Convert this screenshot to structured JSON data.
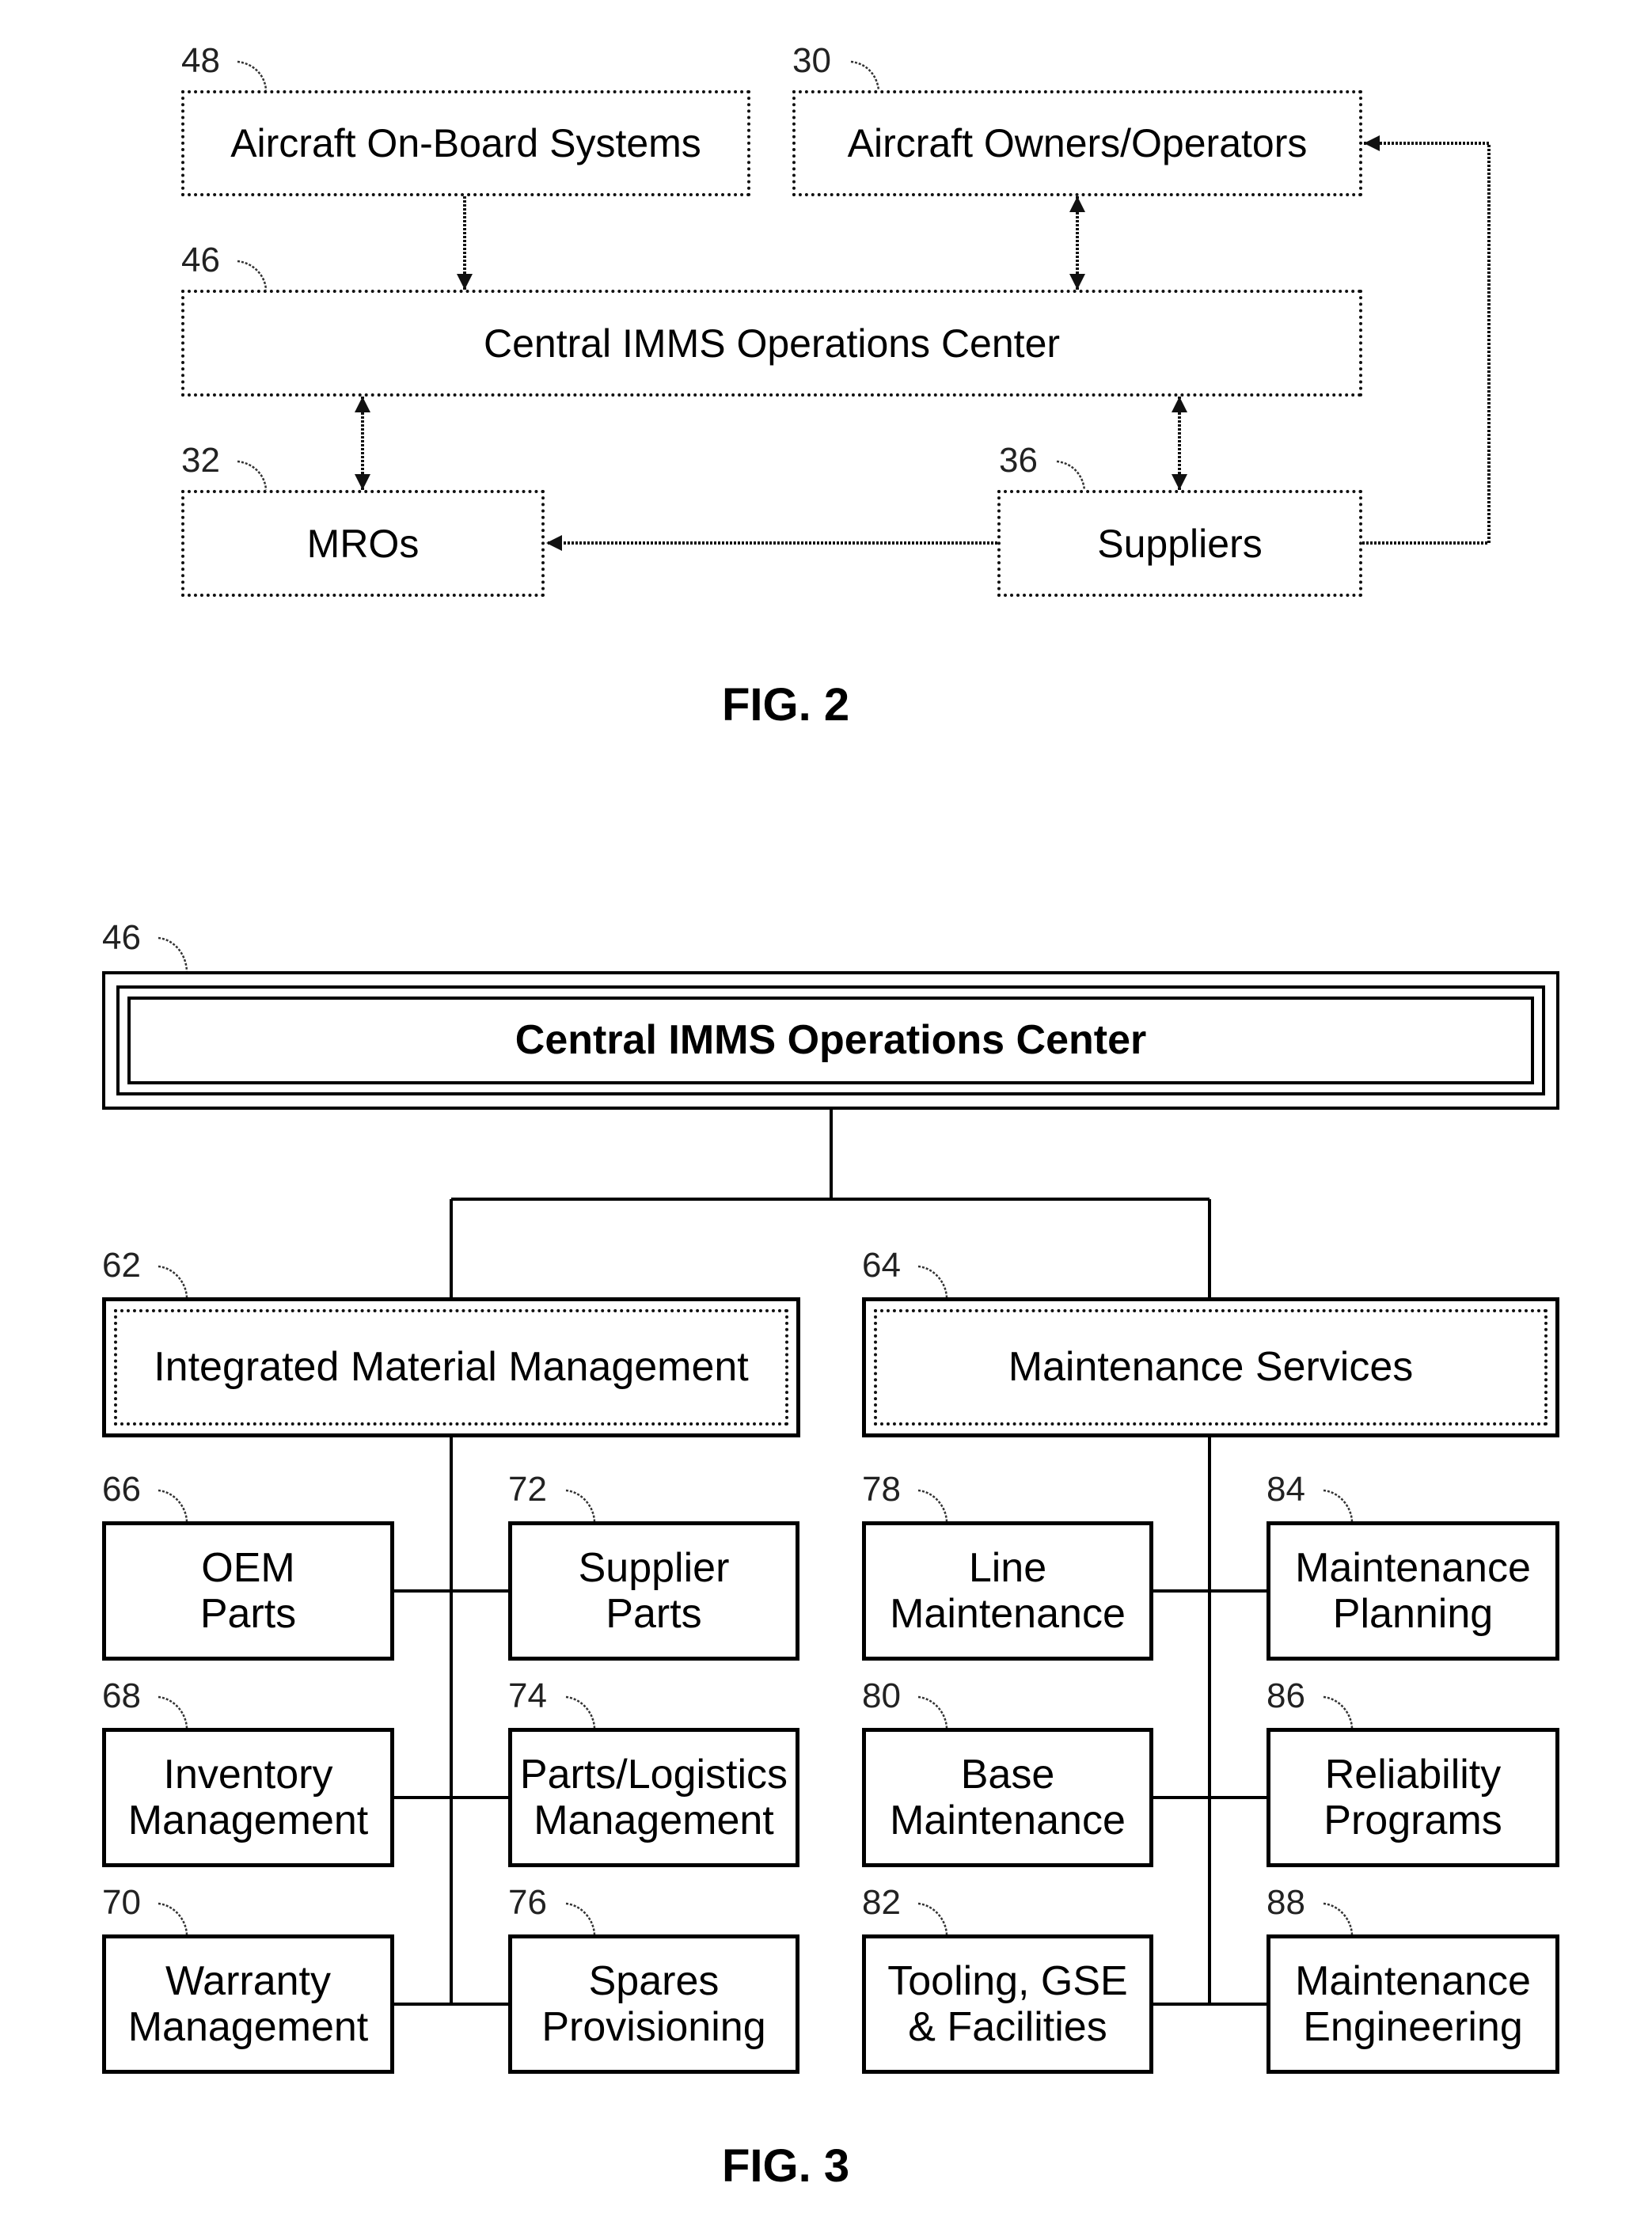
{
  "figure2": {
    "caption": "FIG. 2",
    "nodes": [
      {
        "id": "48",
        "ref": "48",
        "label": "Aircraft On-Board Systems"
      },
      {
        "id": "30",
        "ref": "30",
        "label": "Aircraft Owners/Operators"
      },
      {
        "id": "46",
        "ref": "46",
        "label": "Central IMMS Operations Center"
      },
      {
        "id": "32",
        "ref": "32",
        "label": "MROs"
      },
      {
        "id": "36",
        "ref": "36",
        "label": "Suppliers"
      }
    ],
    "edges": [
      {
        "from": "48",
        "to": "46",
        "direction": "one-way"
      },
      {
        "from": "30",
        "to": "46",
        "direction": "two-way"
      },
      {
        "from": "46",
        "to": "32",
        "direction": "two-way"
      },
      {
        "from": "46",
        "to": "36",
        "direction": "two-way"
      },
      {
        "from": "36",
        "to": "32",
        "direction": "one-way"
      },
      {
        "from": "36",
        "to": "30",
        "direction": "one-way"
      }
    ]
  },
  "figure3": {
    "caption": "FIG. 3",
    "root": {
      "ref": "46",
      "label": "Central IMMS Operations Center"
    },
    "branches": [
      {
        "ref": "62",
        "label": "Integrated Material Management",
        "children": [
          {
            "ref": "66",
            "label": "OEM\nParts"
          },
          {
            "ref": "72",
            "label": "Supplier\nParts"
          },
          {
            "ref": "68",
            "label": "Inventory\nManagement"
          },
          {
            "ref": "74",
            "label": "Parts/Logistics\nManagement"
          },
          {
            "ref": "70",
            "label": "Warranty\nManagement"
          },
          {
            "ref": "76",
            "label": "Spares\nProvisioning"
          }
        ]
      },
      {
        "ref": "64",
        "label": "Maintenance Services",
        "children": [
          {
            "ref": "78",
            "label": "Line\nMaintenance"
          },
          {
            "ref": "84",
            "label": "Maintenance\nPlanning"
          },
          {
            "ref": "80",
            "label": "Base\nMaintenance"
          },
          {
            "ref": "86",
            "label": "Reliability\nPrograms"
          },
          {
            "ref": "82",
            "label": "Tooling, GSE\n& Facilities"
          },
          {
            "ref": "88",
            "label": "Maintenance\nEngineering"
          }
        ]
      }
    ]
  }
}
